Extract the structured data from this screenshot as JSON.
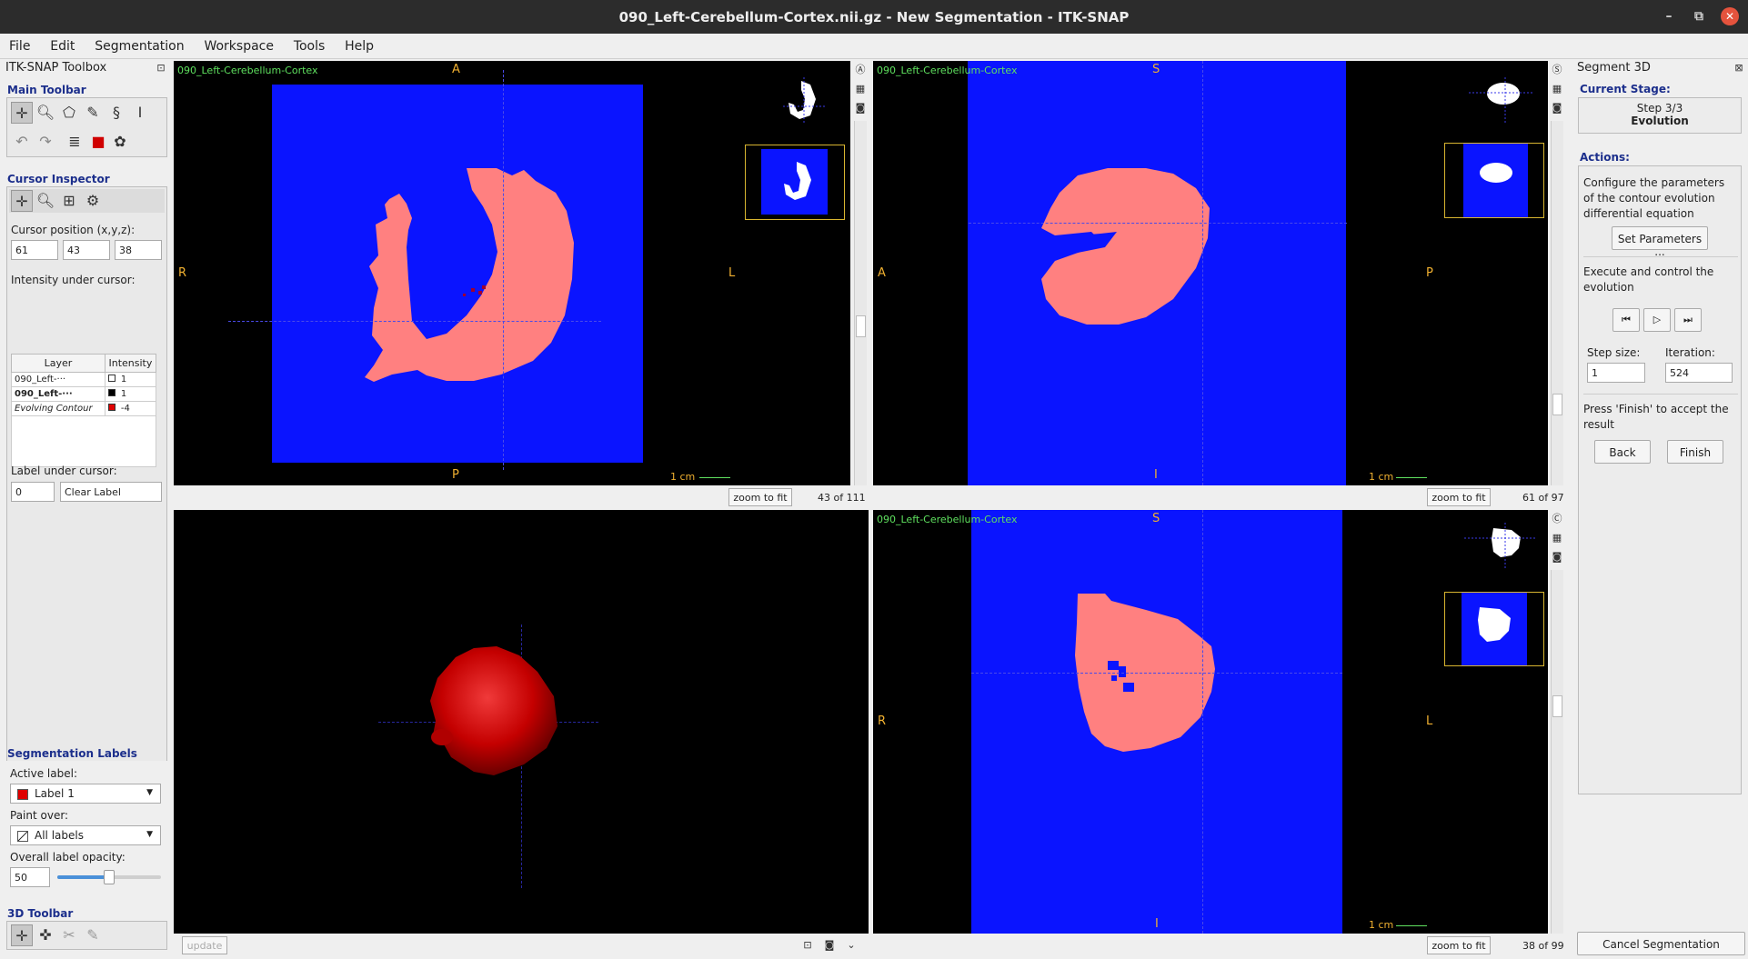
{
  "window": {
    "title": "090_Left-Cerebellum-Cortex.nii.gz - New Segmentation - ITK-SNAP",
    "min": "–",
    "max": "⧉",
    "close": "✕"
  },
  "menu": [
    "File",
    "Edit",
    "Segmentation",
    "Workspace",
    "Tools",
    "Help"
  ],
  "toolbox": {
    "title": "ITK-SNAP Toolbox",
    "main_toolbar": "Main Toolbar",
    "cursor_inspector": "Cursor Inspector",
    "cursor_position_label": "Cursor position (x,y,z):",
    "cursor": [
      "61",
      "43",
      "38"
    ],
    "intensity_label": "Intensity under cursor:",
    "table_headers": [
      "Layer",
      "Intensity"
    ],
    "rows": [
      {
        "layer": "090_Left-···",
        "value": "1",
        "swatch": "#ffffff"
      },
      {
        "layer": "090_Left-···",
        "value": "1",
        "swatch": "#000000"
      },
      {
        "layer": "Evolving Contour",
        "value": "-4",
        "swatch": "#e00000"
      }
    ],
    "label_under_cursor": "Label under cursor:",
    "label_id": "0",
    "label_name": "Clear Label"
  },
  "seg_labels": {
    "title": "Segmentation Labels",
    "active_label_title": "Active label:",
    "active_label": "Label 1",
    "active_color": "#e00000",
    "paint_over_title": "Paint over:",
    "paint_over": "All labels",
    "opacity_title": "Overall label opacity:",
    "opacity": "50",
    "opacity_fraction": 0.5
  },
  "toolbar3d": {
    "title": "3D Toolbar",
    "update": "update"
  },
  "views": {
    "axial": {
      "label": "090_Left-Cerebellum-Cortex",
      "top": "A",
      "bottom": "P",
      "left": "R",
      "right": "L",
      "scale": "1 cm",
      "zoom": "zoom to fit",
      "slice": "43 of 111"
    },
    "sagittal": {
      "label": "090_Left-Cerebellum-Cortex",
      "top": "S",
      "bottom": "I",
      "left": "A",
      "right": "P",
      "scale": "1 cm",
      "zoom": "zoom to fit",
      "slice": "61 of 97"
    },
    "coronal": {
      "label": "090_Left-Cerebellum-Cortex",
      "top": "S",
      "bottom": "I",
      "left": "R",
      "right": "L",
      "scale": "1 cm",
      "zoom": "zoom to fit",
      "slice": "38 of 99"
    }
  },
  "segment3d": {
    "title": "Segment 3D",
    "current_stage": "Current Stage:",
    "step": "Step 3/3",
    "stage": "Evolution",
    "actions": "Actions:",
    "configure_text": "Configure the parameters of the contour evolution differential equation",
    "set_params": "Set Parameters ...",
    "execute_text": "Execute and control the evolution",
    "step_size_label": "Step size:",
    "step_size": "1",
    "iteration_label": "Iteration:",
    "iteration": "524",
    "finish_text": "Press 'Finish' to accept the result",
    "back": "Back",
    "finish": "Finish",
    "cancel": "Cancel Segmentation"
  },
  "colors": {
    "image_bg": "#0a14ff",
    "segmentation": "#ff8080",
    "render3d": "#d40000",
    "accent": "#1c2f8c"
  }
}
